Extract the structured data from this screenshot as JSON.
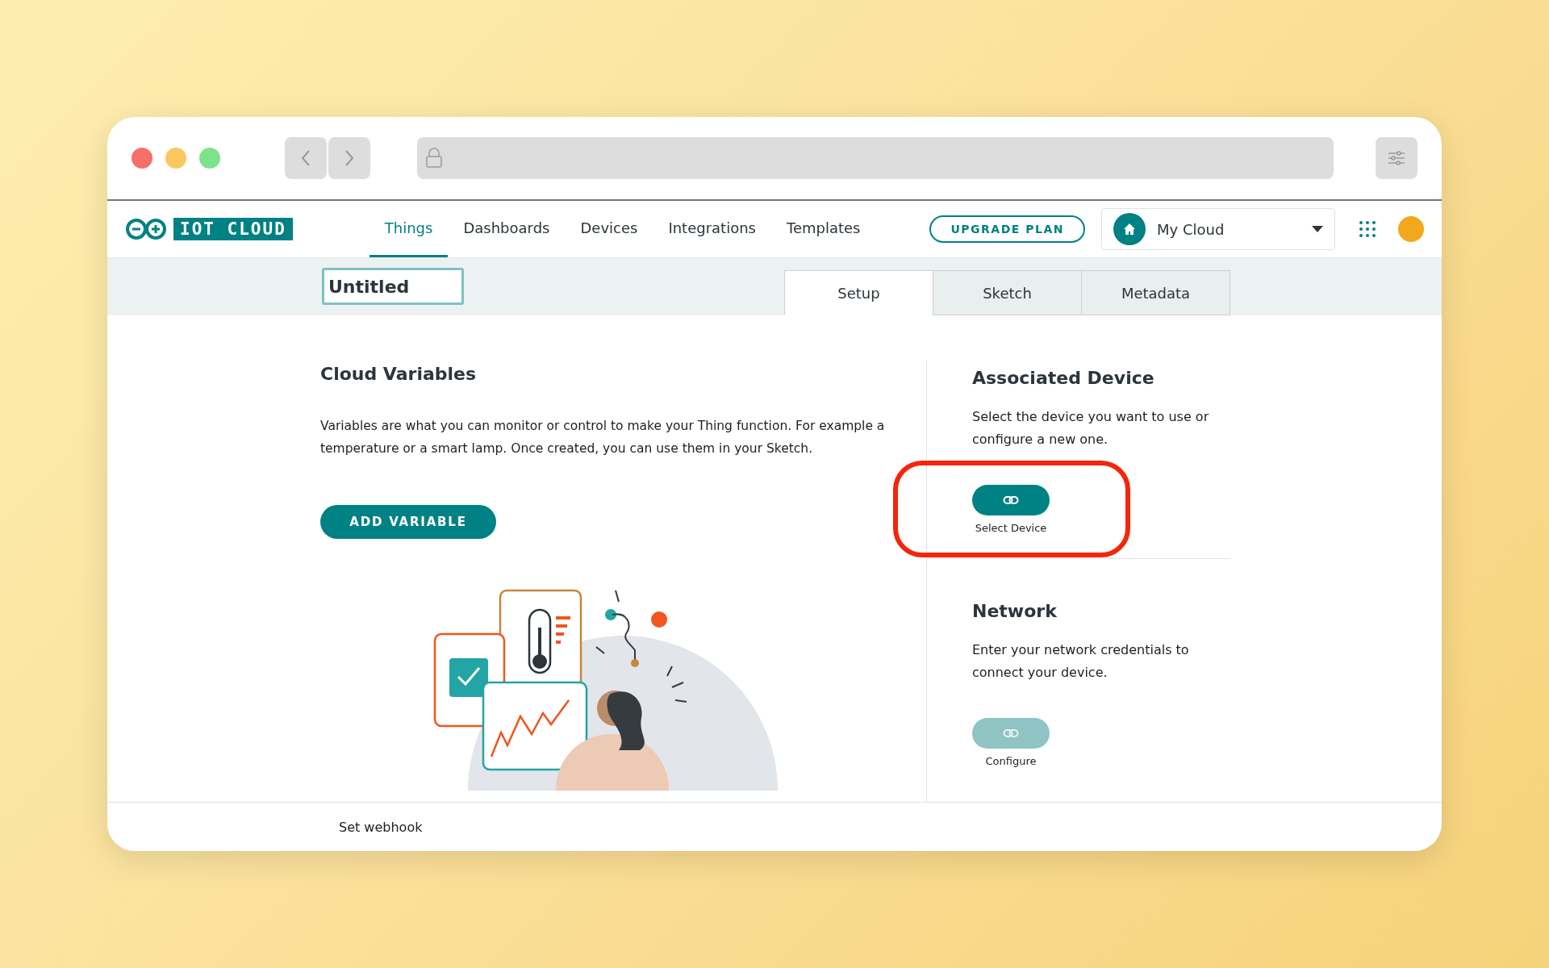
{
  "app": {
    "logo": "IOT CLOUD",
    "nav": [
      {
        "label": "Things",
        "selected": true
      },
      {
        "label": "Dashboards",
        "selected": false
      },
      {
        "label": "Devices",
        "selected": false
      },
      {
        "label": "Integrations",
        "selected": false
      },
      {
        "label": "Templates",
        "selected": false
      }
    ],
    "upgrade_button": "UPGRADE PLAN",
    "space_selector": "My Cloud"
  },
  "thing": {
    "name": "Untitled",
    "tabs": [
      {
        "label": "Setup",
        "selected": true
      },
      {
        "label": "Sketch",
        "selected": false
      },
      {
        "label": "Metadata",
        "selected": false
      }
    ]
  },
  "variables": {
    "title": "Cloud Variables",
    "description": "Variables are what you can monitor or control to make your Thing function. For example a temperature or a smart lamp. Once created, you can use them in your Sketch.",
    "button": "ADD VARIABLE"
  },
  "sections": [
    {
      "title": "Associated Device",
      "description": "Select the device you want to use or configure a new one.",
      "action": "Select Device",
      "disabled": false,
      "highlighted": true
    },
    {
      "title": "Network",
      "description": "Enter your network credentials to connect your device.",
      "action": "Configure",
      "disabled": true,
      "highlighted": false
    }
  ],
  "footer": {
    "link": "Set webhook"
  }
}
